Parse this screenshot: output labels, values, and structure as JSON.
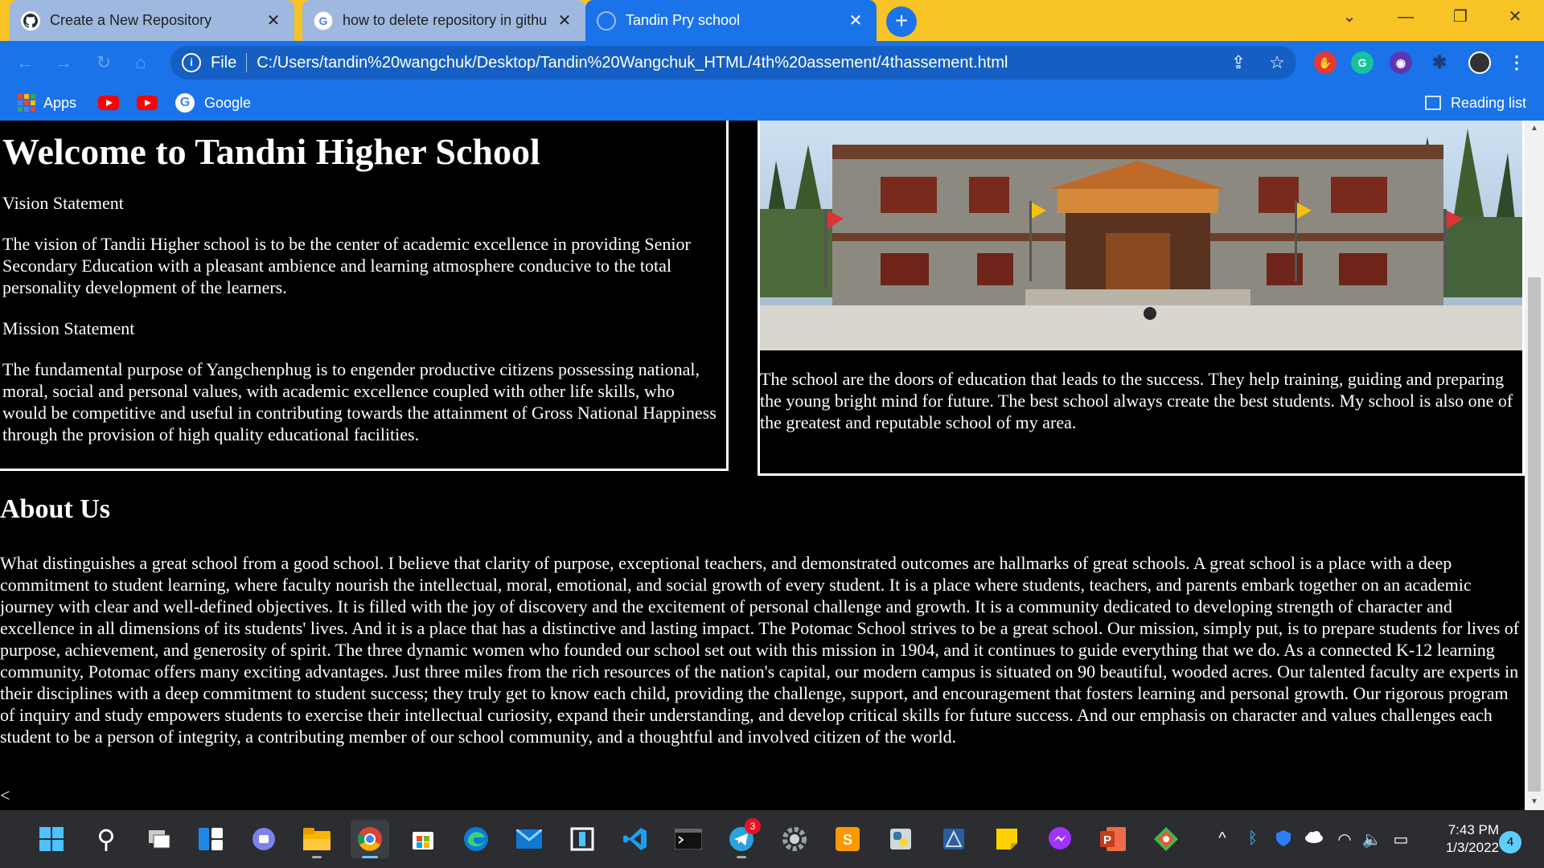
{
  "tabs": [
    {
      "title": "Create a New Repository",
      "favicon": "github-icon",
      "close": "✕"
    },
    {
      "title": "how to delete repository in githu",
      "favicon": "google-icon",
      "close": "✕"
    },
    {
      "title": "Tandin Pry school",
      "favicon": "globe-icon",
      "close": "✕"
    }
  ],
  "new_tab": "+",
  "window_controls": {
    "tab_search": "⌄",
    "minimize": "—",
    "restore": "❐",
    "close": "✕"
  },
  "toolbar": {
    "back": "←",
    "forward": "→",
    "reload": "↻",
    "home": "⌂"
  },
  "omnibox": {
    "info": "i",
    "scheme": "File",
    "url": "C:/Users/tandin%20wangchuk/Desktop/Tandin%20Wangchuk_HTML/4th%20assement/4thassement.html",
    "share": "⇪",
    "star": "☆"
  },
  "extensions": {
    "grammarly": "G",
    "more": "⋮",
    "puzzle": "✱"
  },
  "bookmarks": {
    "apps": "Apps",
    "google": "Google",
    "google_letter": "G",
    "reading_list": "Reading list"
  },
  "page": {
    "heading": "Welcome to Tandni Higher School",
    "vision_label": "Vision Statement",
    "vision_text": "The vision of Tandii Higher school is to be the center of academic excellence in providing Senior Secondary Education with a pleasant ambience and learning atmosphere conducive to the total personality development of the learners.",
    "mission_label": "Mission Statement",
    "mission_text": "The fundamental purpose of Yangchenphug is to engender productive citizens possessing national, moral, social and personal values, with academic excellence coupled with other life skills, who would be competitive and useful in contributing towards the attainment of Gross National Happiness through the provision of high quality educational facilities.",
    "school_text": "The school are the doors of education that leads to the success. They help training, guiding and preparing the young bright mind for future. The best school always create the best students. My school is also one of the greatest and reputable school of my area.",
    "about_heading": "About Us",
    "about_text": "What distinguishes a great school from a good school. I believe that clarity of purpose, exceptional teachers, and demonstrated outcomes are hallmarks of great schools. A great school is a place with a deep commitment to student learning, where faculty nourish the intellectual, moral, emotional, and social growth of every student. It is a place where students, teachers, and parents embark together on an academic journey with clear and well-defined objectives. It is filled with the joy of discovery and the excitement of personal challenge and growth. It is a community dedicated to developing strength of character and excellence in all dimensions of its students' lives. And it is a place that has a distinctive and lasting impact. The Potomac School strives to be a great school. Our mission, simply put, is to prepare students for lives of purpose, achievement, and generosity of spirit. The three dynamic women who founded our school set out with this mission in 1904, and it continues to guide everything that we do. As a connected K-12 learning community, Potomac offers many exciting advantages. Just three miles from the rich resources of the nation's capital, our modern campus is situated on 90 beautiful, wooded acres. Our talented faculty are experts in their disciplines with a deep commitment to student success; they truly get to know each child, providing the challenge, support, and encouragement that fosters learning and personal growth. Our rigorous program of inquiry and study empowers students to exercise their intellectual curiosity, expand their understanding, and develop critical skills for future success. And our emphasis on character and values challenges each student to be a person of integrity, a contributing member of our school community, and a thoughtful and involved citizen of the world.",
    "stray_char": "<"
  },
  "scrollbar": {
    "up": "▲",
    "down": "▼"
  },
  "taskbar": {
    "search": "⚲",
    "telegram_badge": "3",
    "powerpoint": "P",
    "sublime": "S",
    "tray_chevron": "^",
    "bluetooth": "ᛒ",
    "wifi": "◠",
    "volume": "🔈",
    "battery": "▭",
    "time": "7:43 PM",
    "date": "1/3/2022",
    "notifications": "4"
  },
  "colors": {
    "tab_bar": "#f7c325",
    "chrome_blue": "#1a73e8",
    "page_bg": "#000000",
    "taskbar": "#2b2d31"
  }
}
